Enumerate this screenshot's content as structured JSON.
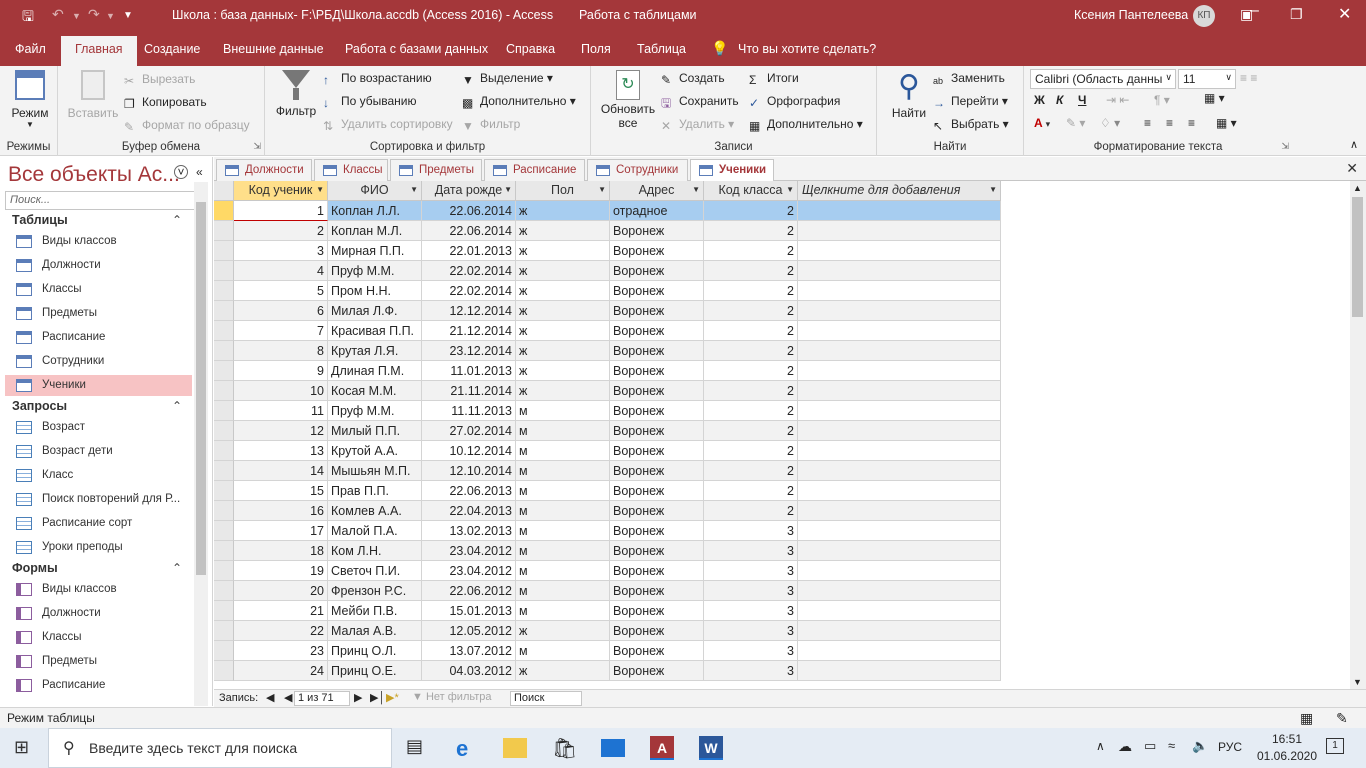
{
  "titlebar": {
    "title": "Школа : база данных- F:\\РБД\\Школа.accdb (Access 2016)  -  Access",
    "context": "Работа с таблицами",
    "user": "Ксения Пантелеева",
    "user_initials": "КП"
  },
  "ribbon_tabs": [
    "Файл",
    "Главная",
    "Создание",
    "Внешние данные",
    "Работа с базами данных",
    "Справка",
    "Поля",
    "Таблица"
  ],
  "tell_me": "Что вы хотите сделать?",
  "ribbon": {
    "modes": {
      "label": "Режимы",
      "view": "Режим"
    },
    "clipboard": {
      "label": "Буфер обмена",
      "paste": "Вставить",
      "cut": "Вырезать",
      "copy": "Копировать",
      "format_painter": "Формат по образцу"
    },
    "sort": {
      "label": "Сортировка и фильтр",
      "filter": "Фильтр",
      "asc": "По возрастанию",
      "desc": "По убыванию",
      "remove": "Удалить сортировку",
      "selection": "Выделение",
      "advanced": "Дополнительно",
      "toggle": "Фильтр"
    },
    "records": {
      "label": "Записи",
      "refresh": "Обновить",
      "refresh2": "все",
      "new": "Создать",
      "save": "Сохранить",
      "delete": "Удалить",
      "totals": "Итоги",
      "spelling": "Орфография",
      "more": "Дополнительно"
    },
    "find": {
      "label": "Найти",
      "find": "Найти",
      "replace": "Заменить",
      "goto": "Перейти",
      "select": "Выбрать"
    },
    "text": {
      "label": "Форматирование текста",
      "font": "Calibri (Область данны",
      "size": "11",
      "bold": "Ж",
      "italic": "К",
      "underline": "Ч"
    }
  },
  "nav": {
    "title": "Все объекты Ac...",
    "search_placeholder": "Поиск...",
    "groups": [
      {
        "name": "Таблицы",
        "items": [
          "Виды классов",
          "Должности",
          "Классы",
          "Предметы",
          "Расписание",
          "Сотрудники",
          "Ученики"
        ]
      },
      {
        "name": "Запросы",
        "items": [
          "Возраст",
          "Возраст дети",
          "Класс",
          "Поиск повторений для Р...",
          "Расписание сорт",
          "Уроки преподы"
        ]
      },
      {
        "name": "Формы",
        "items": [
          "Виды классов",
          "Должности",
          "Классы",
          "Предметы",
          "Расписание"
        ]
      }
    ],
    "selected": "Ученики"
  },
  "doc_tabs": [
    "Должности",
    "Классы",
    "Предметы",
    "Расписание",
    "Сотрудники",
    "Ученики"
  ],
  "active_doc": "Ученики",
  "columns": [
    "Код ученик",
    "ФИО",
    "Дата рожде",
    "Пол",
    "Адрес",
    "Код класса",
    "Щелкните для добавления"
  ],
  "rows": [
    [
      "1",
      "Коплан Л.Л.",
      "22.06.2014",
      "ж",
      "отрадное",
      "2"
    ],
    [
      "2",
      "Коплан М.Л.",
      "22.06.2014",
      "ж",
      "Воронеж",
      "2"
    ],
    [
      "3",
      "Мирная П.П.",
      "22.01.2013",
      "ж",
      "Воронеж",
      "2"
    ],
    [
      "4",
      "Пруф М.М.",
      "22.02.2014",
      "ж",
      "Воронеж",
      "2"
    ],
    [
      "5",
      "Пром Н.Н.",
      "22.02.2014",
      "ж",
      "Воронеж",
      "2"
    ],
    [
      "6",
      "Милая Л.Ф.",
      "12.12.2014",
      "ж",
      "Воронеж",
      "2"
    ],
    [
      "7",
      "Красивая П.П.",
      "21.12.2014",
      "ж",
      "Воронеж",
      "2"
    ],
    [
      "8",
      "Крутая Л.Я.",
      "23.12.2014",
      "ж",
      "Воронеж",
      "2"
    ],
    [
      "9",
      "Длиная П.М.",
      "11.01.2013",
      "ж",
      "Воронеж",
      "2"
    ],
    [
      "10",
      "Косая М.М.",
      "21.11.2014",
      "ж",
      "Воронеж",
      "2"
    ],
    [
      "11",
      "Пруф М.М.",
      "11.11.2013",
      "м",
      "Воронеж",
      "2"
    ],
    [
      "12",
      "Милый П.П.",
      "27.02.2014",
      "м",
      "Воронеж",
      "2"
    ],
    [
      "13",
      "Крутой А.А.",
      "10.12.2014",
      "м",
      "Воронеж",
      "2"
    ],
    [
      "14",
      "Мышьян М.П.",
      "12.10.2014",
      "м",
      "Воронеж",
      "2"
    ],
    [
      "15",
      "Прав П.П.",
      "22.06.2013",
      "м",
      "Воронеж",
      "2"
    ],
    [
      "16",
      "Комлев А.А.",
      "22.04.2013",
      "м",
      "Воронеж",
      "2"
    ],
    [
      "17",
      "Малой П.А.",
      "13.02.2013",
      "м",
      "Воронеж",
      "3"
    ],
    [
      "18",
      "Ком Л.Н.",
      "23.04.2012",
      "м",
      "Воронеж",
      "3"
    ],
    [
      "19",
      "Светоч П.И.",
      "23.04.2012",
      "м",
      "Воронеж",
      "3"
    ],
    [
      "20",
      "Френзон Р.С.",
      "22.06.2012",
      "м",
      "Воронеж",
      "3"
    ],
    [
      "21",
      "Мейби П.В.",
      "15.01.2013",
      "м",
      "Воронеж",
      "3"
    ],
    [
      "22",
      "Малая А.В.",
      "12.05.2012",
      "ж",
      "Воронеж",
      "3"
    ],
    [
      "23",
      "Принц О.Л.",
      "13.07.2012",
      "м",
      "Воронеж",
      "3"
    ],
    [
      "24",
      "Принц О.Е.",
      "04.03.2012",
      "ж",
      "Воронеж",
      "3"
    ]
  ],
  "record_nav": {
    "label": "Запись:",
    "position": "1 из 71",
    "filter": "Нет фильтра",
    "search": "Поиск"
  },
  "status": "Режим таблицы",
  "taskbar": {
    "search": "Введите здесь текст для поиска",
    "lang": "РУС",
    "time": "16:51",
    "date": "01.06.2020",
    "notifications": "1"
  }
}
